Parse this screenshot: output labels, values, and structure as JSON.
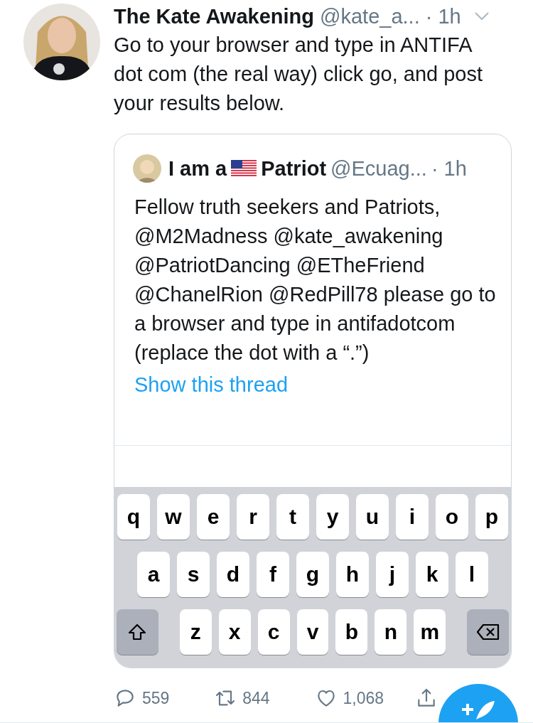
{
  "tweet": {
    "author": "The Kate Awakening",
    "handle": "@kate_a...",
    "time": "· 1h",
    "text": "Go to your browser and type in ANTIFA dot com (the real way) click go, and post your results below.",
    "quote": {
      "name_start": "I am a",
      "name_end": "Patriot",
      "handle": "@Ecuag...",
      "time": "· 1h",
      "text": "Fellow truth seekers and Patriots, @M2Madness @kate_awakening @PatriotDancing @ETheFriend @ChanelRion @RedPill78 please go to a browser and type in antifadotcom (replace the dot with a “.”)",
      "link": "Show this thread",
      "keyboard": {
        "rows": [
          [
            "q",
            "w",
            "e",
            "r",
            "t",
            "y",
            "u",
            "i",
            "o",
            "p"
          ],
          [
            "a",
            "s",
            "d",
            "f",
            "g",
            "h",
            "j",
            "k",
            "l"
          ],
          [
            "z",
            "x",
            "c",
            "v",
            "b",
            "n",
            "m"
          ]
        ]
      }
    },
    "actions": [
      {
        "kind": "reply",
        "count": "559"
      },
      {
        "kind": "retweet",
        "count": "844"
      },
      {
        "kind": "like",
        "count": "1,068"
      },
      {
        "kind": "share"
      }
    ]
  }
}
